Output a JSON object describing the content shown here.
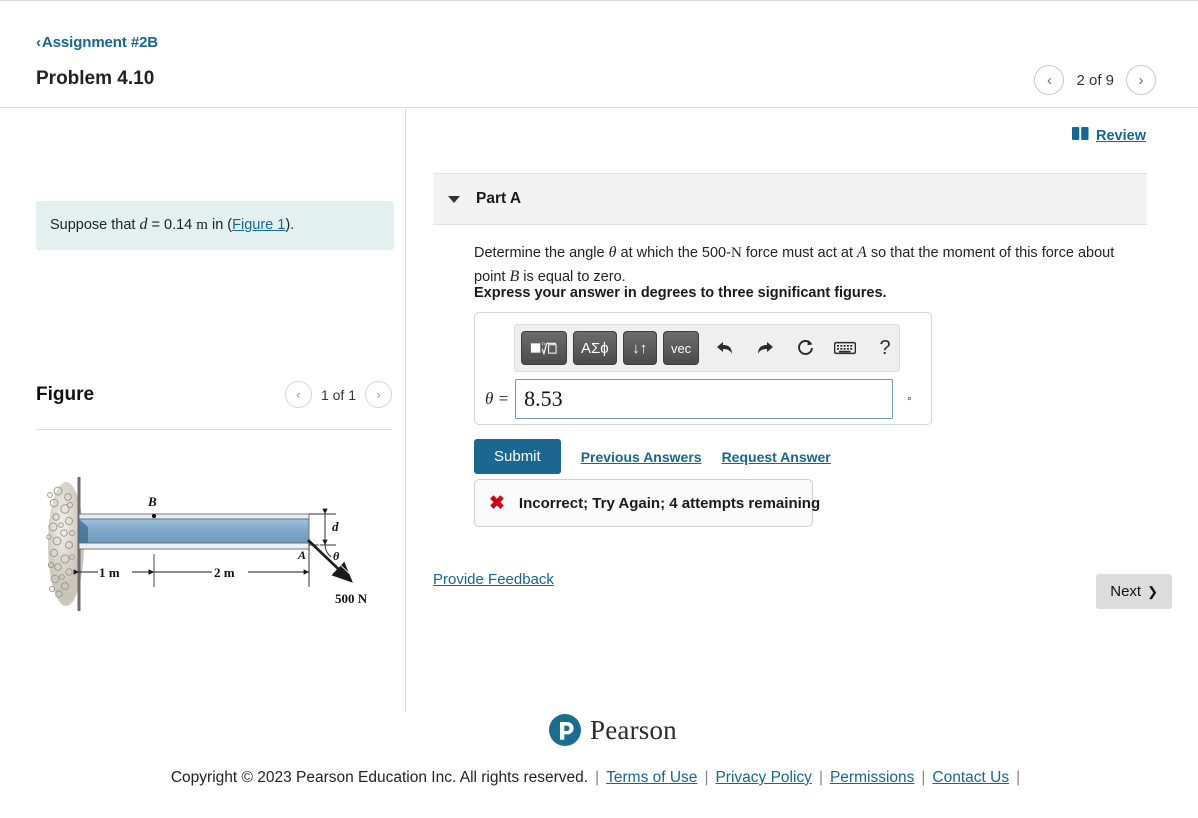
{
  "header": {
    "assignment_chevron": "‹",
    "assignment_label": "Assignment #2B",
    "problem_title": "Problem 4.10",
    "prev_icon": "‹",
    "next_icon": "›",
    "pager_label": "2 of 9"
  },
  "left": {
    "suppose_prefix": "Suppose that",
    "suppose_var": "d",
    "suppose_eq": "= 0.14",
    "suppose_unit": "m",
    "suppose_mid": "in (",
    "figure_link": "Figure 1",
    "suppose_suffix": ").",
    "figure_title": "Figure",
    "figure_prev_icon": "‹",
    "figure_next_icon": "›",
    "figure_pager_label": "1 of 1",
    "diagram": {
      "label_B": "B",
      "label_A": "A",
      "label_d": "d",
      "label_theta": "θ",
      "dim_1m": "1 m",
      "dim_2m": "2 m",
      "force_label": "500 N"
    }
  },
  "right": {
    "review_icon": "book-icon",
    "review_label": "Review",
    "part_title": "Part A",
    "question_text": "Determine the angle θ at which the 500-N force must act at A so that the moment of this force about point B is equal to zero.",
    "question_q1": "Determine the angle",
    "question_theta": "θ",
    "question_q2": "at which the 500-",
    "question_N": "N",
    "question_q3": "force must act at",
    "question_A": "A",
    "question_q4": "so that the moment of this force about point",
    "question_B": "B",
    "question_q5": "is equal to zero.",
    "instruction": "Express your answer in degrees to three significant figures.",
    "toolbar": {
      "sqrt_button": "√",
      "greek_button": "ΑΣϕ",
      "arrows_button": "↓↑",
      "vec_button": "vec",
      "undo_icon": "↰",
      "redo_icon": "↱",
      "reset_icon": "⟳",
      "keyboard_icon": "keyboard-icon",
      "help_icon": "?"
    },
    "answer_label": "θ =",
    "answer_value": "8.53",
    "answer_placeholder": "",
    "answer_unit": "°",
    "submit_label": "Submit",
    "previous_answers_label": "Previous Answers",
    "request_answer_label": "Request Answer",
    "feedback_icon": "✖",
    "feedback_text": "Incorrect; Try Again; 4 attempts remaining",
    "provide_feedback_label": "Provide Feedback",
    "next_label": "Next",
    "next_icon": "❯"
  },
  "footer": {
    "logo_letter": "P",
    "logo_word": "Pearson",
    "copyright": "Copyright © 2023 Pearson Education Inc. All rights reserved.",
    "terms_label": "Terms of Use",
    "privacy_label": "Privacy Policy",
    "permissions_label": "Permissions",
    "contact_label": "Contact Us",
    "separator": "|"
  },
  "colors": {
    "link": "#15678f",
    "submit": "#1b6790",
    "error": "#d0021b",
    "suppose_bg": "#e2f0f0",
    "beam": "#7ba7c7"
  }
}
